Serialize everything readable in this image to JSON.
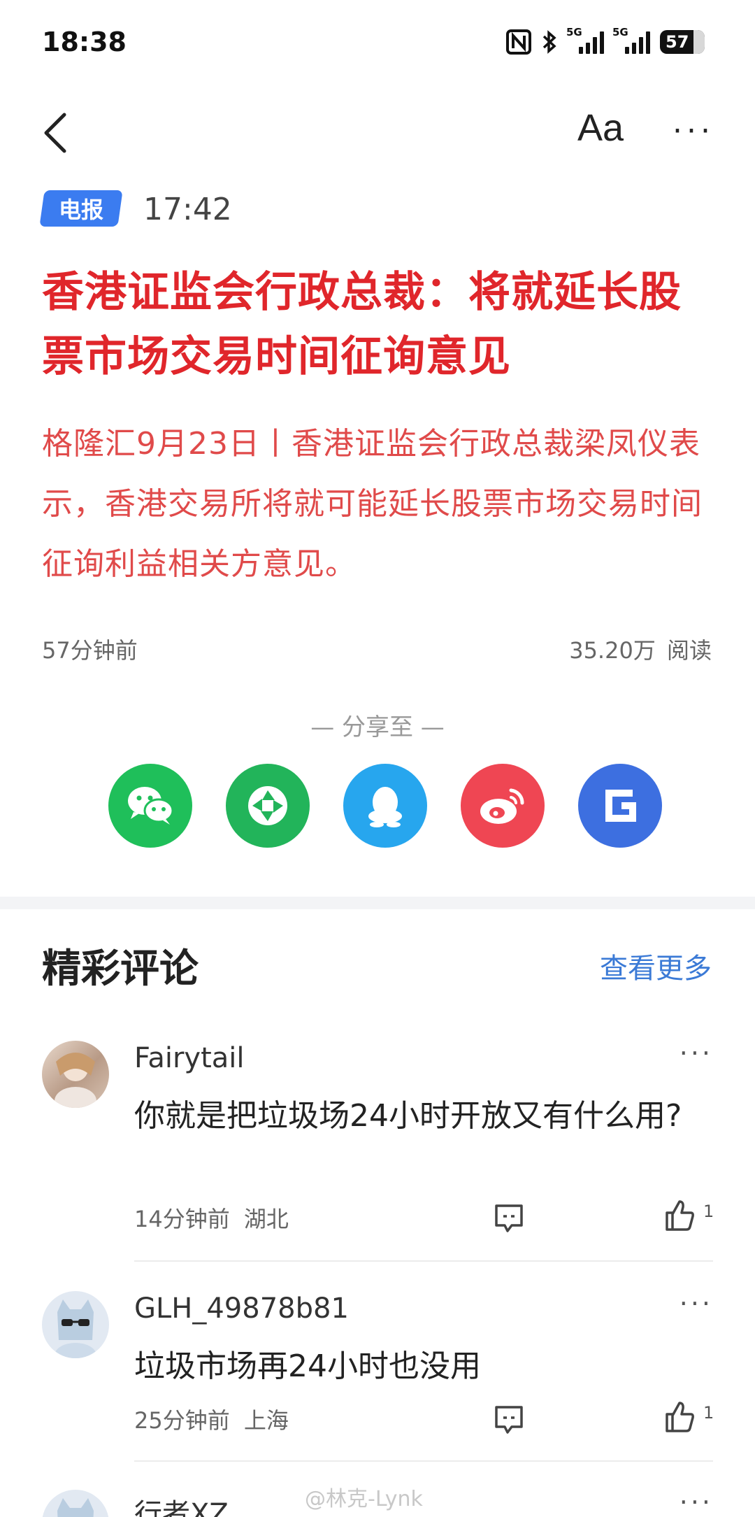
{
  "status_bar": {
    "time": "18:38",
    "signal1_label": "5G",
    "signal2_label": "5G",
    "battery": "57"
  },
  "nav": {
    "font_button": "Aa",
    "more_button": "···"
  },
  "article": {
    "tag": "电报",
    "time": "17:42",
    "headline": "香港证监会行政总裁：将就延长股票市场交易时间征询意见",
    "summary": "格隆汇9月23日丨香港证监会行政总裁梁凤仪表示，香港交易所将就可能延长股票市场交易时间征询利益相关方意见。",
    "age": "57分钟前",
    "reads": "35.20万 阅读"
  },
  "share": {
    "label": "— 分享至 —",
    "targets": [
      {
        "icon": "wechat-icon",
        "color": "#1fbf5a"
      },
      {
        "icon": "moments-icon",
        "color": "#22b45a"
      },
      {
        "icon": "qq-icon",
        "color": "#27a6ee"
      },
      {
        "icon": "weibo-icon",
        "color": "#ef4653"
      },
      {
        "icon": "g-app-icon",
        "color": "#3d6fe0"
      }
    ]
  },
  "comments": {
    "title": "精彩评论",
    "more": "查看更多",
    "items": [
      {
        "user": "Fairytail",
        "text": "你就是把垃圾场24小时开放又有什么用?",
        "time": "14分钟前",
        "location": "湖北",
        "likes": "1",
        "more": "···"
      },
      {
        "user": "GLH_49878b81",
        "text": "垃圾市场再24小时也没用",
        "time": "25分钟前",
        "location": "上海",
        "likes": "1",
        "more": "···"
      },
      {
        "user": "行者XZ",
        "more": "···"
      }
    ]
  },
  "watermark": "@林克-Lynk",
  "colors": {
    "headline": "#e0262b",
    "accent_blue": "#3b7cf0",
    "link_blue": "#3b7ad6"
  }
}
